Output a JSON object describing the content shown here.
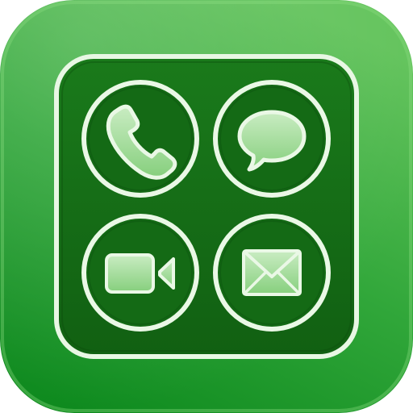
{
  "icon": {
    "glyphs": [
      "phone-icon",
      "speech-bubble-icon",
      "video-camera-icon",
      "envelope-icon"
    ]
  },
  "colors": {
    "tile_light": "#5cbf55",
    "tile_dark": "#0f8a1d",
    "panel": "#156b17",
    "outline": "#e6f6e2",
    "glyph_fill": "#a8dca0"
  }
}
